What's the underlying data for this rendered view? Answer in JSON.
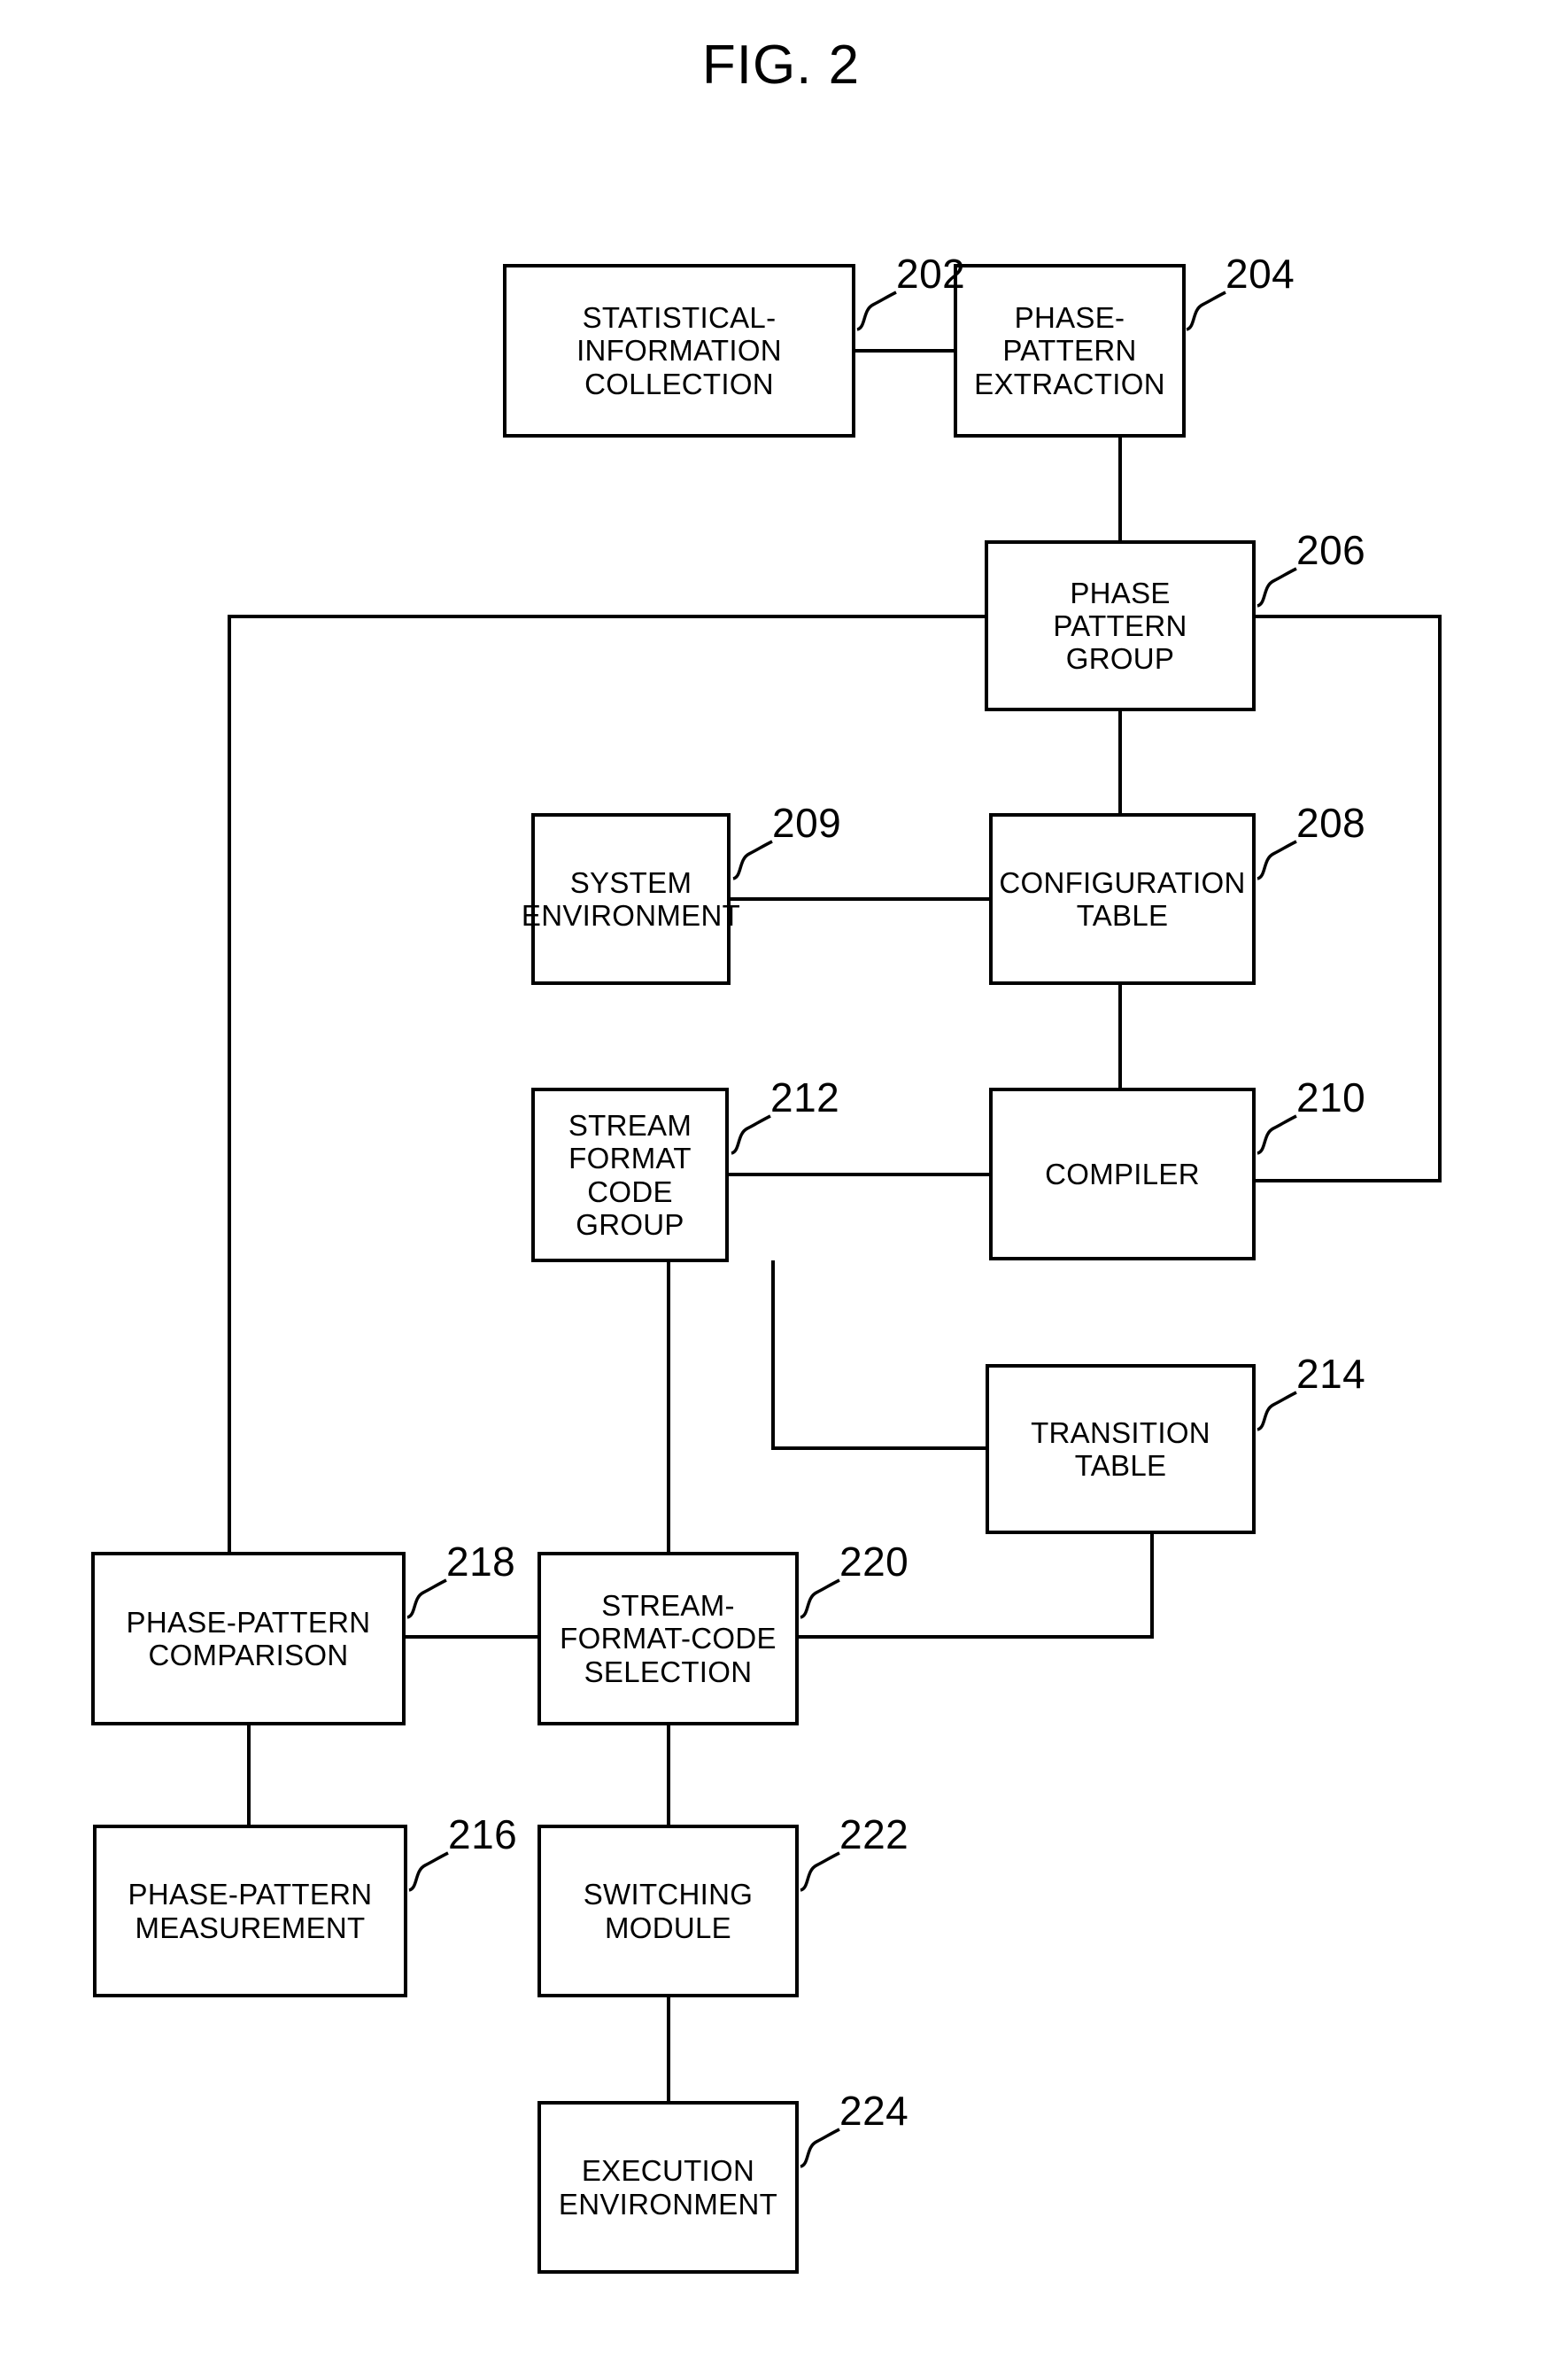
{
  "figure": {
    "title": "FIG. 2"
  },
  "nodes": [
    {
      "ref": "202",
      "label": "STATISTICAL-\nINFORMATION\nCOLLECTION"
    },
    {
      "ref": "204",
      "label": "PHASE-PATTERN\nEXTRACTION"
    },
    {
      "ref": "206",
      "label": "PHASE\nPATTERN\nGROUP"
    },
    {
      "ref": "209",
      "label": "SYSTEM\nENVIRONMENT"
    },
    {
      "ref": "208",
      "label": "CONFIGURATION\nTABLE"
    },
    {
      "ref": "212",
      "label": "STREAM\nFORMAT\nCODE GROUP"
    },
    {
      "ref": "210",
      "label": "COMPILER"
    },
    {
      "ref": "214",
      "label": "TRANSITION\nTABLE"
    },
    {
      "ref": "218",
      "label": "PHASE-PATTERN\nCOMPARISON"
    },
    {
      "ref": "220",
      "label": "STREAM-\nFORMAT-CODE\nSELECTION"
    },
    {
      "ref": "216",
      "label": "PHASE-PATTERN\nMEASUREMENT"
    },
    {
      "ref": "222",
      "label": "SWITCHING\nMODULE"
    },
    {
      "ref": "224",
      "label": "EXECUTION\nENVIRONMENT"
    }
  ]
}
